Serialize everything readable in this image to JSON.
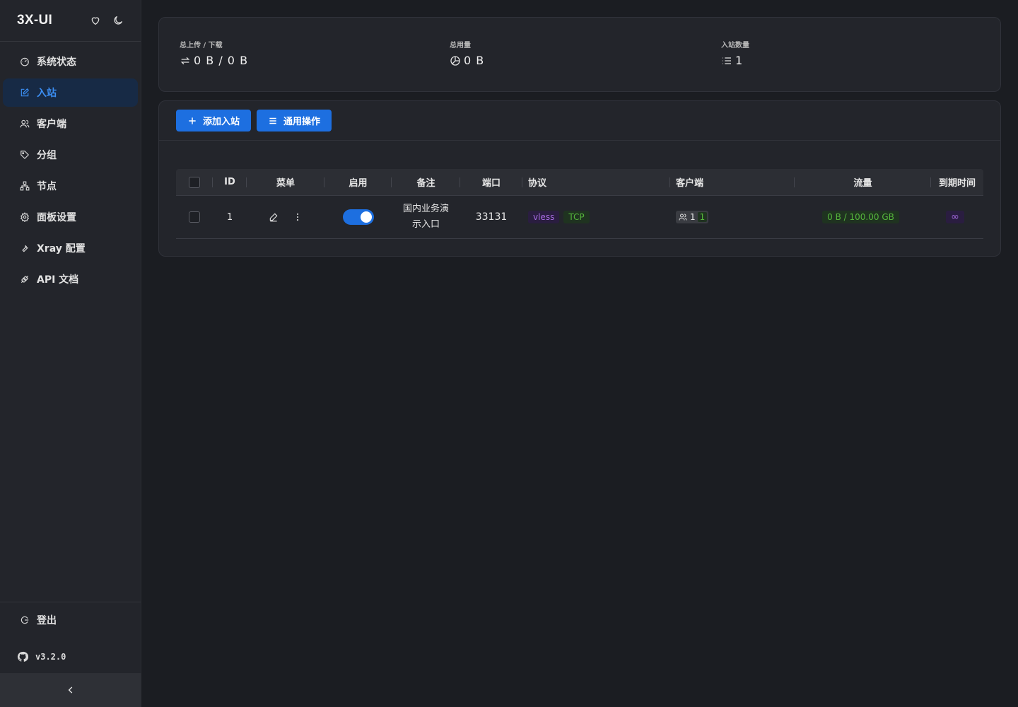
{
  "brand": {
    "title": "3X-UI"
  },
  "sidebar": {
    "items": [
      {
        "label": "系统状态",
        "icon": "dashboard-icon"
      },
      {
        "label": "入站",
        "icon": "edit-square-icon",
        "active": true
      },
      {
        "label": "客户端",
        "icon": "users-icon"
      },
      {
        "label": "分组",
        "icon": "tag-icon"
      },
      {
        "label": "节点",
        "icon": "cluster-icon"
      },
      {
        "label": "面板设置",
        "icon": "gear-icon"
      },
      {
        "label": "Xray 配置",
        "icon": "tool-icon"
      },
      {
        "label": "API 文档",
        "icon": "api-icon"
      }
    ],
    "logout_label": "登出",
    "version": "v3.2.0"
  },
  "stats": {
    "upload_download": {
      "label": "总上传 / 下载",
      "value": "0 B / 0 B"
    },
    "total_usage": {
      "label": "总用量",
      "value": "0 B"
    },
    "inbound_count": {
      "label": "入站数量",
      "value": "1"
    }
  },
  "toolbar": {
    "add_label": "添加入站",
    "general_label": "通用操作"
  },
  "table": {
    "headers": {
      "id": "ID",
      "menu": "菜单",
      "enable": "启用",
      "remark": "备注",
      "port": "端口",
      "protocol": "协议",
      "clients": "客户端",
      "traffic": "流量",
      "expiry": "到期时间"
    },
    "rows": [
      {
        "id": "1",
        "enabled": true,
        "remark": "国内业务演示入口",
        "port": "33131",
        "protocol": "vless",
        "transport": "TCP",
        "clients_total": "1",
        "clients_online": "1",
        "traffic": "0 B / 100.00 GB",
        "expiry": "∞"
      }
    ]
  },
  "colors": {
    "accent": "#1d6fe0",
    "active_nav_bg": "#172a45",
    "active_nav_text": "#3b8ef3",
    "purple_tag": "#a56ae0",
    "green_tag": "#56b63c"
  }
}
